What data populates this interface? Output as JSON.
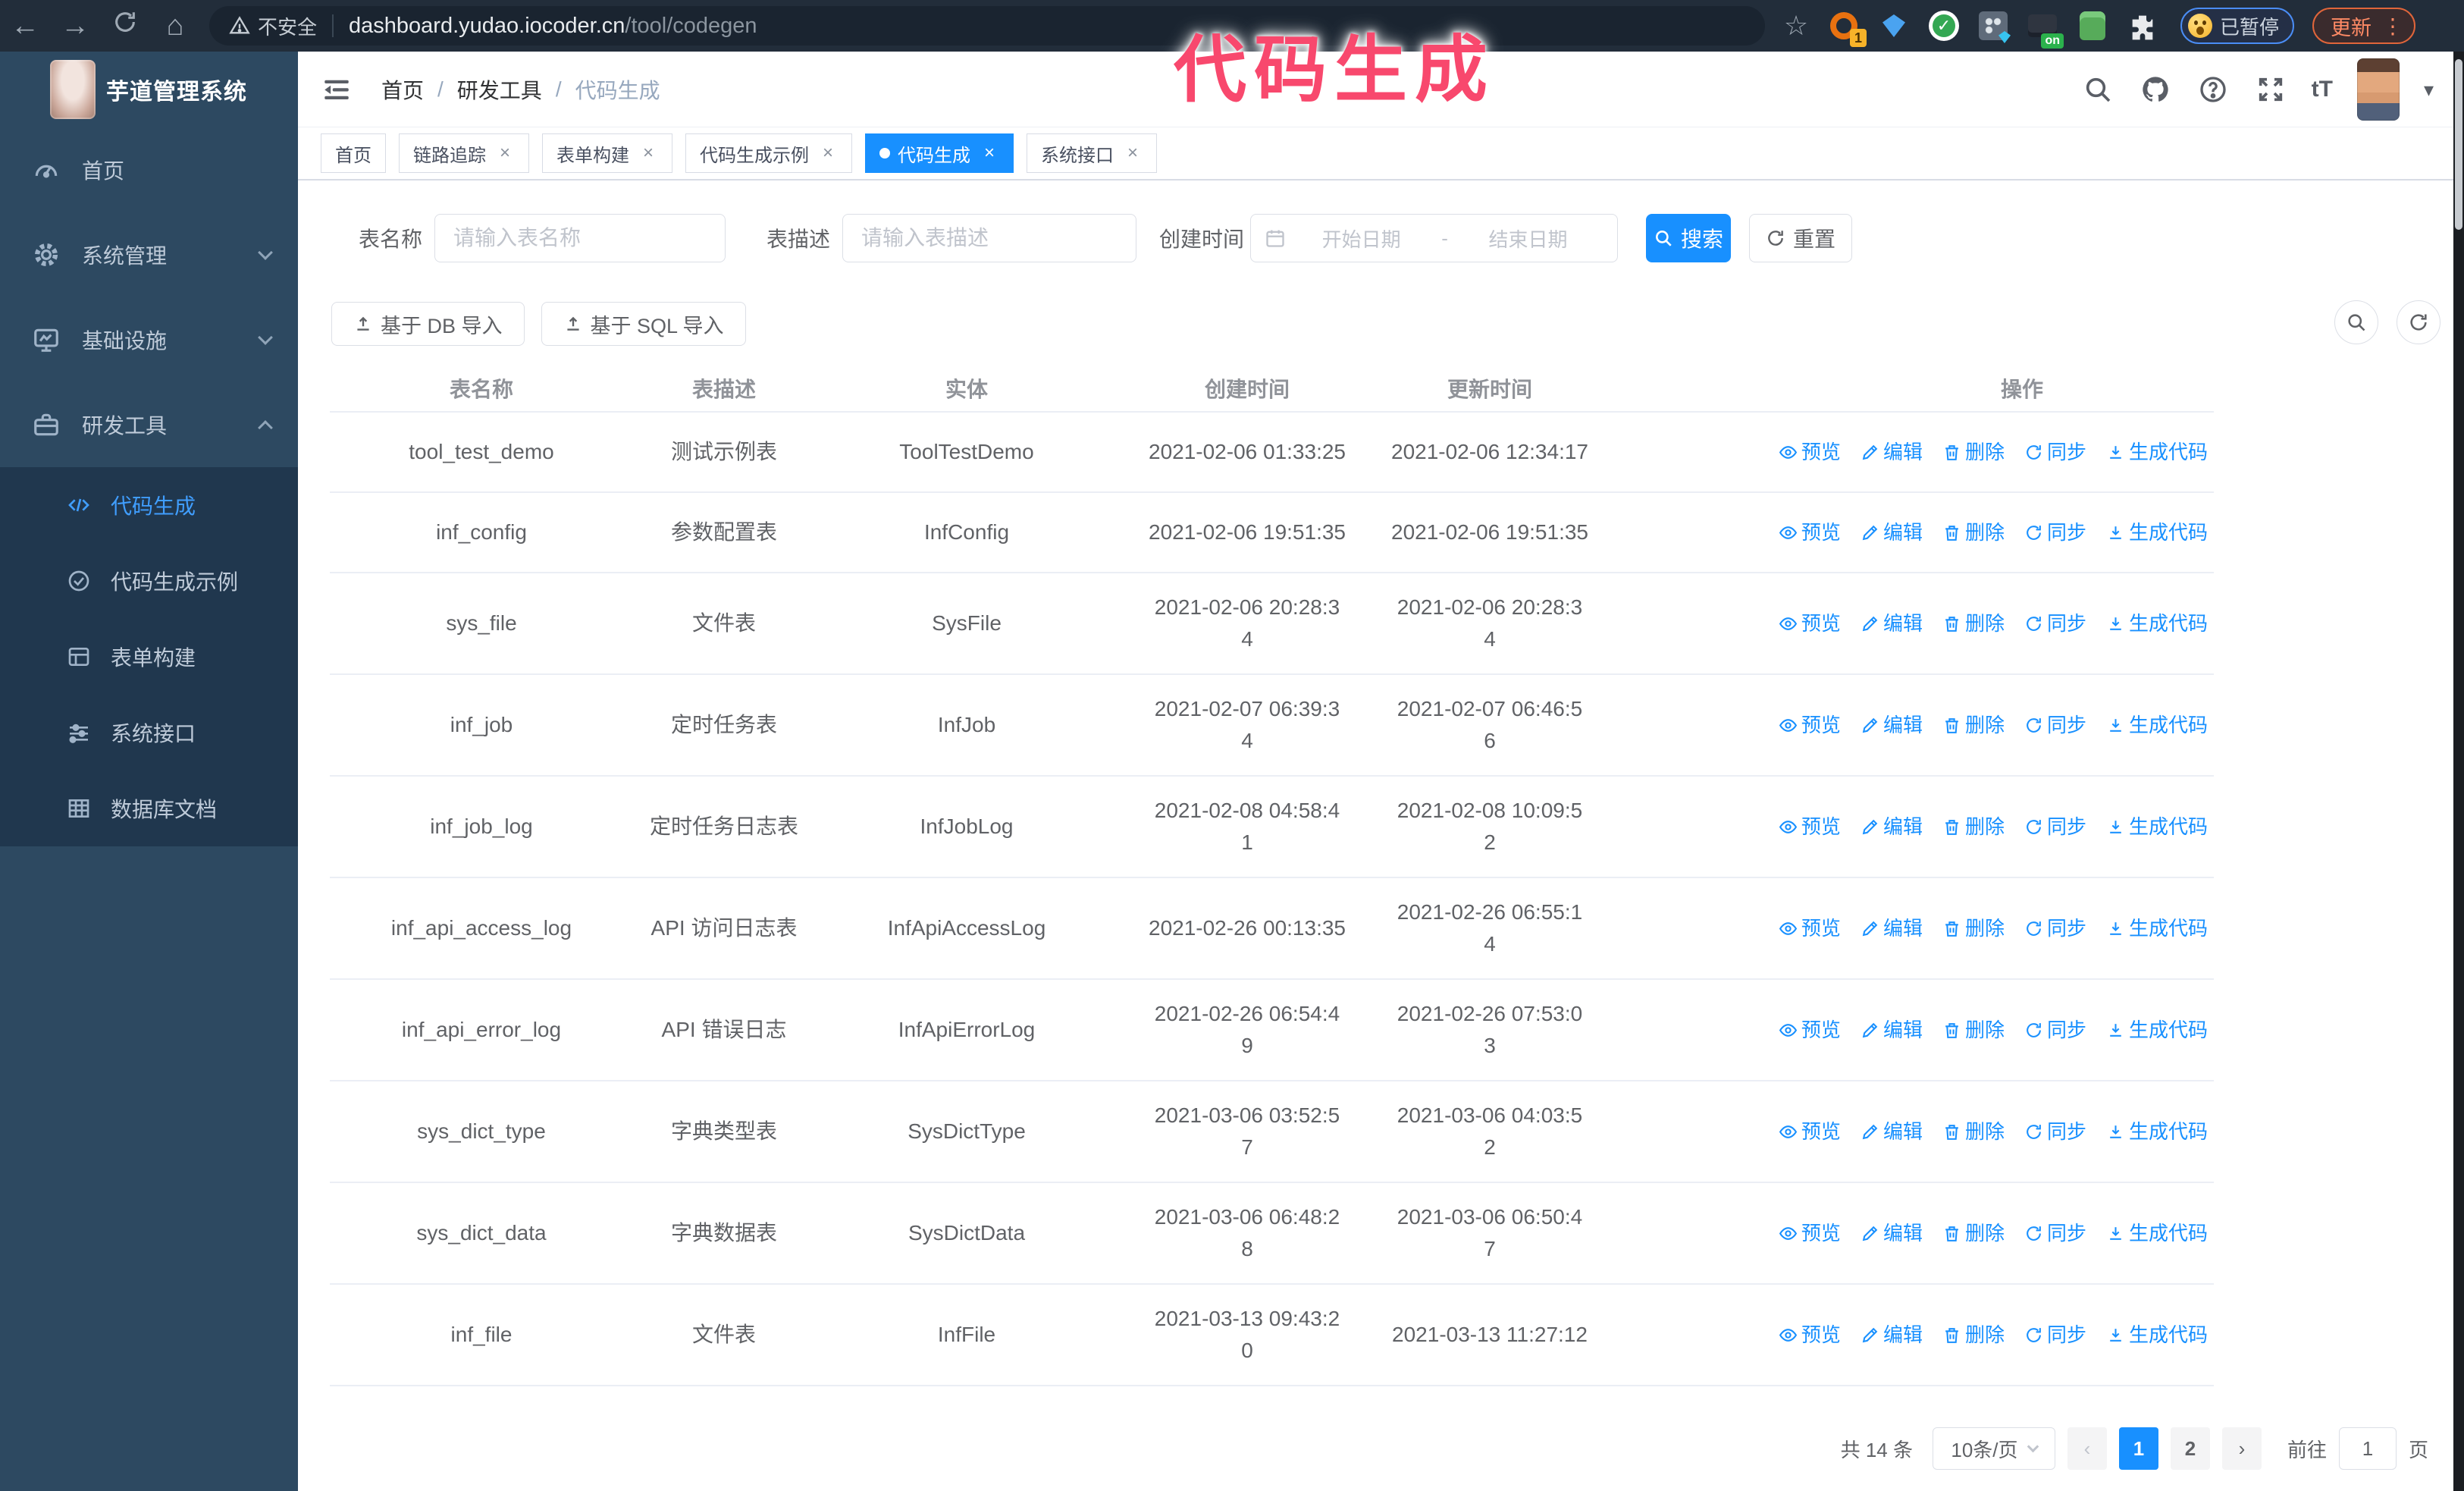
{
  "browser": {
    "security_label": "不安全",
    "url_host": "dashboard.yudao.iocoder.cn",
    "url_path": "/tool/codegen",
    "extension_badge_1": "1",
    "extension_badge_on": "on",
    "paused_badge": "已暂停",
    "update_button": "更新"
  },
  "annotation": {
    "text": "代码生成",
    "color": "#f8486d"
  },
  "icons": {
    "back": "←",
    "forward": "→",
    "home": "⌂",
    "star": "☆",
    "ellipsis": "⋮",
    "close": "×",
    "caret_down": "▾",
    "font_size": "tT",
    "question": "?",
    "prev": "‹",
    "next": "›",
    "check": "✓"
  },
  "sidebar": {
    "logo_title": "芋道管理系统",
    "menu": [
      {
        "label": "首页",
        "icon": "dashboard-icon"
      },
      {
        "label": "系统管理",
        "icon": "gear-icon"
      },
      {
        "label": "基础设施",
        "icon": "monitor-icon"
      },
      {
        "label": "研发工具",
        "icon": "toolbox-icon"
      }
    ],
    "submenu": [
      {
        "label": "代码生成",
        "icon": "code-icon",
        "active": true
      },
      {
        "label": "代码生成示例",
        "icon": "example-icon"
      },
      {
        "label": "表单构建",
        "icon": "form-icon"
      },
      {
        "label": "系统接口",
        "icon": "api-icon"
      },
      {
        "label": "数据库文档",
        "icon": "database-icon"
      }
    ]
  },
  "header": {
    "breadcrumb": [
      "首页",
      "研发工具",
      "代码生成"
    ],
    "separator": "/"
  },
  "tabs": [
    {
      "label": "首页",
      "closable": false,
      "active": false
    },
    {
      "label": "链路追踪",
      "closable": true,
      "active": false
    },
    {
      "label": "表单构建",
      "closable": true,
      "active": false
    },
    {
      "label": "代码生成示例",
      "closable": true,
      "active": false
    },
    {
      "label": "代码生成",
      "closable": true,
      "active": true
    },
    {
      "label": "系统接口",
      "closable": true,
      "active": false
    }
  ],
  "filters": {
    "table_name_label": "表名称",
    "table_name_placeholder": "请输入表名称",
    "table_desc_label": "表描述",
    "table_desc_placeholder": "请输入表描述",
    "create_time_label": "创建时间",
    "date_start_placeholder": "开始日期",
    "date_separator": "-",
    "date_end_placeholder": "结束日期",
    "search_button": "搜索",
    "reset_button": "重置"
  },
  "toolbar": {
    "import_db_button": "基于 DB 导入",
    "import_sql_button": "基于 SQL 导入"
  },
  "table": {
    "columns": [
      "表名称",
      "表描述",
      "实体",
      "创建时间",
      "更新时间",
      "操作"
    ],
    "actions": [
      "预览",
      "编辑",
      "删除",
      "同步",
      "生成代码"
    ],
    "rows": [
      {
        "name": "tool_test_demo",
        "desc": "测试示例表",
        "entity": "ToolTestDemo",
        "created": "2021-02-06 01:33:25",
        "updated": "2021-02-06 12:34:17"
      },
      {
        "name": "inf_config",
        "desc": "参数配置表",
        "entity": "InfConfig",
        "created": "2021-02-06 19:51:35",
        "updated": "2021-02-06 19:51:35"
      },
      {
        "name": "sys_file",
        "desc": "文件表",
        "entity": "SysFile",
        "created": "2021-02-06 20:28:3\n4",
        "updated": "2021-02-06 20:28:3\n4"
      },
      {
        "name": "inf_job",
        "desc": "定时任务表",
        "entity": "InfJob",
        "created": "2021-02-07 06:39:3\n4",
        "updated": "2021-02-07 06:46:5\n6"
      },
      {
        "name": "inf_job_log",
        "desc": "定时任务日志表",
        "entity": "InfJobLog",
        "created": "2021-02-08 04:58:4\n1",
        "updated": "2021-02-08 10:09:5\n2"
      },
      {
        "name": "inf_api_access_log",
        "desc": "API 访问日志表",
        "entity": "InfApiAccessLog",
        "created": "2021-02-26 00:13:35",
        "updated": "2021-02-26 06:55:1\n4"
      },
      {
        "name": "inf_api_error_log",
        "desc": "API 错误日志",
        "entity": "InfApiErrorLog",
        "created": "2021-02-26 06:54:4\n9",
        "updated": "2021-02-26 07:53:0\n3"
      },
      {
        "name": "sys_dict_type",
        "desc": "字典类型表",
        "entity": "SysDictType",
        "created": "2021-03-06 03:52:5\n7",
        "updated": "2021-03-06 04:03:5\n2"
      },
      {
        "name": "sys_dict_data",
        "desc": "字典数据表",
        "entity": "SysDictData",
        "created": "2021-03-06 06:48:2\n8",
        "updated": "2021-03-06 06:50:4\n7"
      },
      {
        "name": "inf_file",
        "desc": "文件表",
        "entity": "InfFile",
        "created": "2021-03-13 09:43:2\n0",
        "updated": "2021-03-13 11:27:12"
      }
    ]
  },
  "pagination": {
    "total": "共 14 条",
    "page_size": "10条/页",
    "pages": [
      {
        "label": "1",
        "active": true
      },
      {
        "label": "2",
        "active": false
      }
    ],
    "goto_label": "前往",
    "goto_value": "1",
    "page_unit": "页"
  },
  "colors": {
    "accent": "#1890ff",
    "active_menu_text": "#409eff",
    "annotation_pink": "#f8486d",
    "sidebar_bg": "#2d4961",
    "submenu_bg": "#20374e",
    "toolbar_bg": "#222d3a"
  }
}
